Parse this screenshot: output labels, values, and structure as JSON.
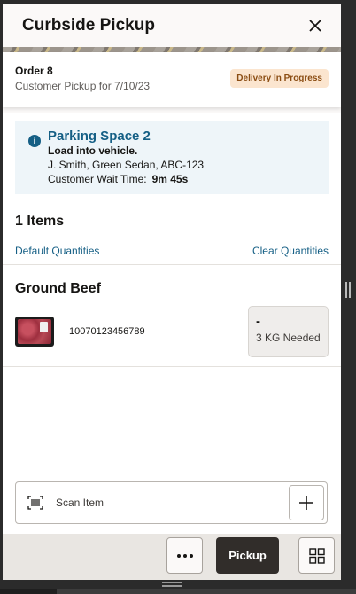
{
  "header": {
    "title": "Curbside Pickup"
  },
  "order": {
    "title": "Order 8",
    "subtitle": "Customer Pickup for 7/10/23",
    "status_badge": "Delivery In Progress"
  },
  "parking": {
    "title": "Parking Space 2",
    "instruction": "Load into vehicle.",
    "vehicle": "J. Smith, Green Sedan, ABC-123",
    "wait_label": "Customer Wait Time:",
    "wait_value": "9m 45s"
  },
  "items": {
    "count_label": "1 Items",
    "default_link": "Default Quantities",
    "clear_link": "Clear Quantities",
    "list": [
      {
        "name": "Ground Beef",
        "sku": "10070123456789",
        "quantity": "-",
        "needed": "3 KG Needed"
      }
    ]
  },
  "scan": {
    "placeholder": "Scan Item"
  },
  "footer": {
    "pickup_label": "Pickup"
  },
  "colors": {
    "accent": "#155f85",
    "primary_button": "#312d2a",
    "badge_bg": "#fbe5cf",
    "badge_text": "#8b4d13"
  }
}
